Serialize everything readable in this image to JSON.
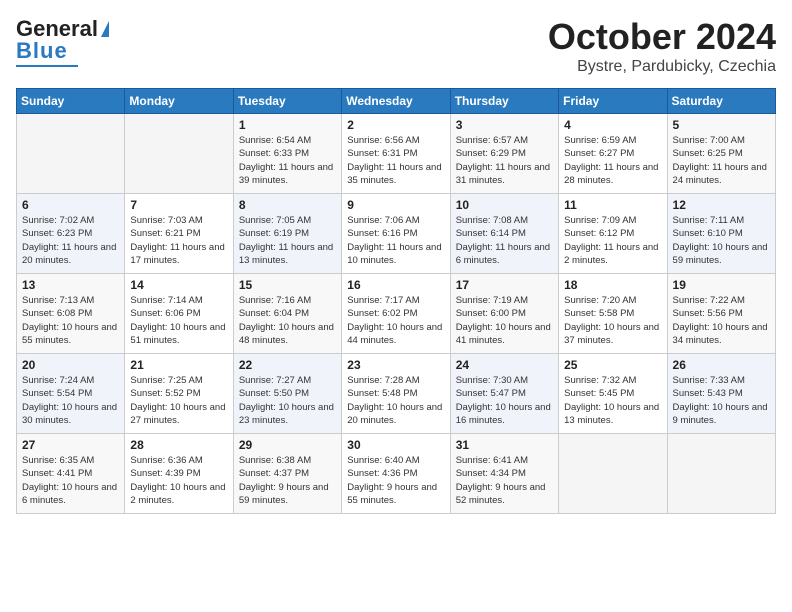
{
  "header": {
    "logo_line1": "General",
    "logo_line2": "Blue",
    "month": "October 2024",
    "location": "Bystre, Pardubicky, Czechia"
  },
  "weekdays": [
    "Sunday",
    "Monday",
    "Tuesday",
    "Wednesday",
    "Thursday",
    "Friday",
    "Saturday"
  ],
  "weeks": [
    [
      {
        "day": "",
        "info": ""
      },
      {
        "day": "",
        "info": ""
      },
      {
        "day": "1",
        "info": "Sunrise: 6:54 AM\nSunset: 6:33 PM\nDaylight: 11 hours and 39 minutes."
      },
      {
        "day": "2",
        "info": "Sunrise: 6:56 AM\nSunset: 6:31 PM\nDaylight: 11 hours and 35 minutes."
      },
      {
        "day": "3",
        "info": "Sunrise: 6:57 AM\nSunset: 6:29 PM\nDaylight: 11 hours and 31 minutes."
      },
      {
        "day": "4",
        "info": "Sunrise: 6:59 AM\nSunset: 6:27 PM\nDaylight: 11 hours and 28 minutes."
      },
      {
        "day": "5",
        "info": "Sunrise: 7:00 AM\nSunset: 6:25 PM\nDaylight: 11 hours and 24 minutes."
      }
    ],
    [
      {
        "day": "6",
        "info": "Sunrise: 7:02 AM\nSunset: 6:23 PM\nDaylight: 11 hours and 20 minutes."
      },
      {
        "day": "7",
        "info": "Sunrise: 7:03 AM\nSunset: 6:21 PM\nDaylight: 11 hours and 17 minutes."
      },
      {
        "day": "8",
        "info": "Sunrise: 7:05 AM\nSunset: 6:19 PM\nDaylight: 11 hours and 13 minutes."
      },
      {
        "day": "9",
        "info": "Sunrise: 7:06 AM\nSunset: 6:16 PM\nDaylight: 11 hours and 10 minutes."
      },
      {
        "day": "10",
        "info": "Sunrise: 7:08 AM\nSunset: 6:14 PM\nDaylight: 11 hours and 6 minutes."
      },
      {
        "day": "11",
        "info": "Sunrise: 7:09 AM\nSunset: 6:12 PM\nDaylight: 11 hours and 2 minutes."
      },
      {
        "day": "12",
        "info": "Sunrise: 7:11 AM\nSunset: 6:10 PM\nDaylight: 10 hours and 59 minutes."
      }
    ],
    [
      {
        "day": "13",
        "info": "Sunrise: 7:13 AM\nSunset: 6:08 PM\nDaylight: 10 hours and 55 minutes."
      },
      {
        "day": "14",
        "info": "Sunrise: 7:14 AM\nSunset: 6:06 PM\nDaylight: 10 hours and 51 minutes."
      },
      {
        "day": "15",
        "info": "Sunrise: 7:16 AM\nSunset: 6:04 PM\nDaylight: 10 hours and 48 minutes."
      },
      {
        "day": "16",
        "info": "Sunrise: 7:17 AM\nSunset: 6:02 PM\nDaylight: 10 hours and 44 minutes."
      },
      {
        "day": "17",
        "info": "Sunrise: 7:19 AM\nSunset: 6:00 PM\nDaylight: 10 hours and 41 minutes."
      },
      {
        "day": "18",
        "info": "Sunrise: 7:20 AM\nSunset: 5:58 PM\nDaylight: 10 hours and 37 minutes."
      },
      {
        "day": "19",
        "info": "Sunrise: 7:22 AM\nSunset: 5:56 PM\nDaylight: 10 hours and 34 minutes."
      }
    ],
    [
      {
        "day": "20",
        "info": "Sunrise: 7:24 AM\nSunset: 5:54 PM\nDaylight: 10 hours and 30 minutes."
      },
      {
        "day": "21",
        "info": "Sunrise: 7:25 AM\nSunset: 5:52 PM\nDaylight: 10 hours and 27 minutes."
      },
      {
        "day": "22",
        "info": "Sunrise: 7:27 AM\nSunset: 5:50 PM\nDaylight: 10 hours and 23 minutes."
      },
      {
        "day": "23",
        "info": "Sunrise: 7:28 AM\nSunset: 5:48 PM\nDaylight: 10 hours and 20 minutes."
      },
      {
        "day": "24",
        "info": "Sunrise: 7:30 AM\nSunset: 5:47 PM\nDaylight: 10 hours and 16 minutes."
      },
      {
        "day": "25",
        "info": "Sunrise: 7:32 AM\nSunset: 5:45 PM\nDaylight: 10 hours and 13 minutes."
      },
      {
        "day": "26",
        "info": "Sunrise: 7:33 AM\nSunset: 5:43 PM\nDaylight: 10 hours and 9 minutes."
      }
    ],
    [
      {
        "day": "27",
        "info": "Sunrise: 6:35 AM\nSunset: 4:41 PM\nDaylight: 10 hours and 6 minutes."
      },
      {
        "day": "28",
        "info": "Sunrise: 6:36 AM\nSunset: 4:39 PM\nDaylight: 10 hours and 2 minutes."
      },
      {
        "day": "29",
        "info": "Sunrise: 6:38 AM\nSunset: 4:37 PM\nDaylight: 9 hours and 59 minutes."
      },
      {
        "day": "30",
        "info": "Sunrise: 6:40 AM\nSunset: 4:36 PM\nDaylight: 9 hours and 55 minutes."
      },
      {
        "day": "31",
        "info": "Sunrise: 6:41 AM\nSunset: 4:34 PM\nDaylight: 9 hours and 52 minutes."
      },
      {
        "day": "",
        "info": ""
      },
      {
        "day": "",
        "info": ""
      }
    ]
  ]
}
